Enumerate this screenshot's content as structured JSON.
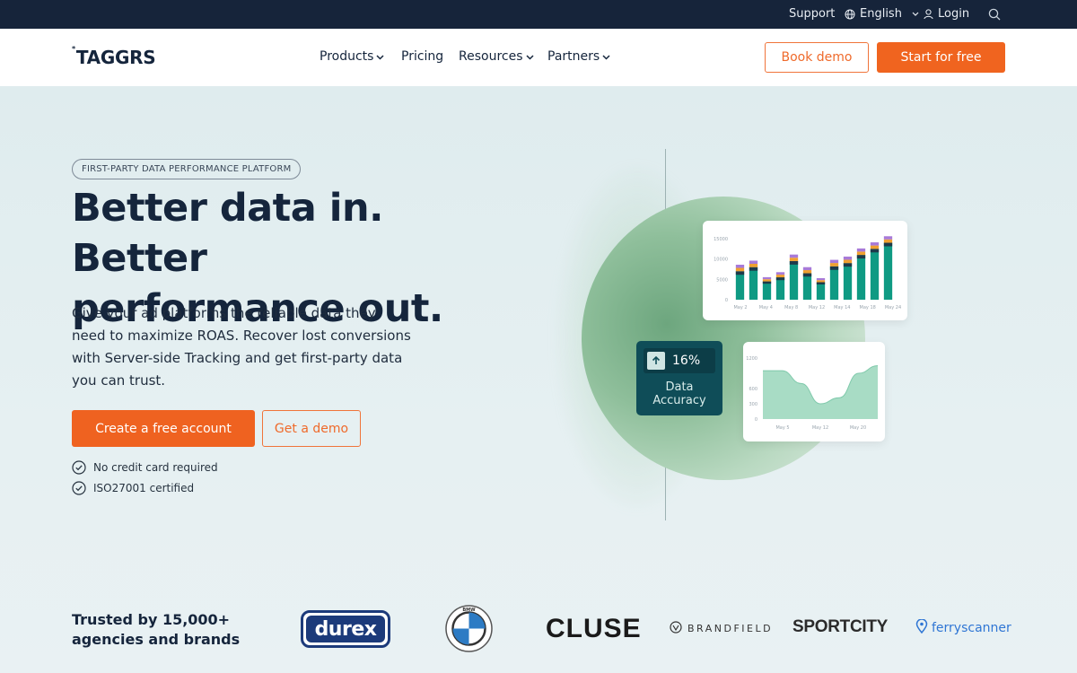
{
  "topbar": {
    "support": "Support",
    "language": "English",
    "login": "Login",
    "icons": [
      "globe-icon",
      "chevron-down-icon",
      "user-icon",
      "search-icon"
    ]
  },
  "nav": {
    "logo": "TAGGRS",
    "logo_mark": "*",
    "items": [
      {
        "label": "Products"
      },
      {
        "label": "Pricing"
      },
      {
        "label": "Resources"
      },
      {
        "label": "Partners"
      }
    ],
    "book_demo": "Book demo",
    "start_free": "Start for free"
  },
  "hero": {
    "eyebrow": "FIRST-PARTY DATA PERFORMANCE PLATFORM",
    "headline_line1": "Better data in. Better",
    "headline_line2": "performance out.",
    "subtext": "Give your ad platforms the reliable data they need to maximize ROAS. Recover lost conversions with Server-side Tracking and get first-party data you can trust.",
    "cta_primary": "Create a free account",
    "cta_secondary": "Get a demo",
    "checks": [
      "No credit card required",
      "ISO27001 certified"
    ]
  },
  "illustration": {
    "stat_value": "16%",
    "stat_label_1": "Data",
    "stat_label_2": "Accuracy",
    "bar_chart": {
      "type": "bar",
      "y_ticks": [
        "15000",
        "10000",
        "5000",
        "0"
      ],
      "x_labels": [
        "May 2",
        "May 4",
        "May 8",
        "May 12",
        "May 14",
        "May 18",
        "May 24"
      ],
      "values": [
        7000,
        8000,
        4500,
        5500,
        9500,
        6500,
        4300,
        8200,
        9000,
        11000,
        12500,
        14000
      ],
      "colors": {
        "main": "#0f9a83",
        "dark": "#1e3a4a",
        "orange": "#f0a030",
        "purple": "#a87ad8"
      }
    },
    "area_chart": {
      "type": "area",
      "y_ticks": [
        "1200",
        "600",
        "300",
        "0"
      ],
      "x_labels": [
        "May 5",
        "May 12",
        "May 20"
      ],
      "values": [
        950,
        950,
        700,
        300,
        420,
        900,
        1050
      ],
      "color": "#a8dcc5"
    }
  },
  "trusted": {
    "line1": "Trusted by 15,000+",
    "line2": "agencies and brands",
    "logos": {
      "durex": "durex",
      "bmw": "BMW",
      "cluse": "CLUSE",
      "brandfield": "BRANDFIELD",
      "sportcity": "SPORTCITY",
      "ferryscanner": "ferryscanner"
    }
  }
}
